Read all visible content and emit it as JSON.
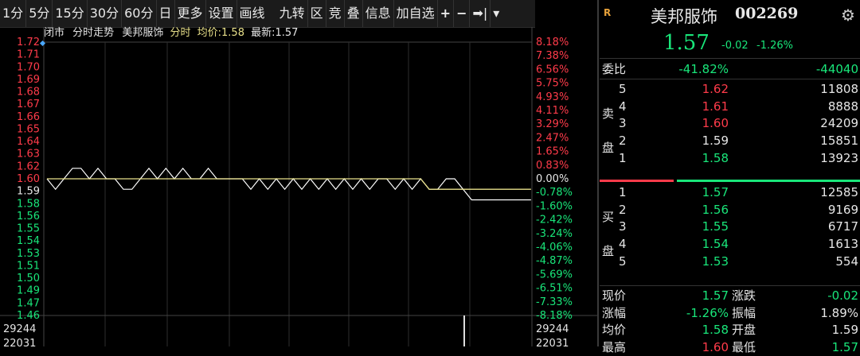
{
  "toolbar": {
    "items": [
      "1分",
      "5分",
      "15分",
      "30分",
      "60分",
      "日",
      "更多",
      "设置",
      "画线",
      "九转",
      "区",
      "竞",
      "叠",
      "信息",
      "加自选",
      "+",
      "−",
      "➡|",
      "▾"
    ]
  },
  "chart_caption": {
    "mode1": "闭市",
    "mode2": "分时走势",
    "name": "美邦服饰",
    "sub": "分时",
    "avg_label": "均价:",
    "avg": "1.58",
    "latest_label": "最新:",
    "latest": "1.57"
  },
  "chart_data": {
    "type": "line",
    "title": "",
    "xlabel": "",
    "ylabel": "",
    "ylim": [
      1.46,
      1.72
    ],
    "prev_close": 1.59,
    "y_ticks_left": [
      "1.72",
      "1.71",
      "1.70",
      "1.69",
      "1.68",
      "1.67",
      "1.66",
      "1.65",
      "1.64",
      "1.63",
      "1.62",
      "1.60",
      "1.59",
      "1.58",
      "1.56",
      "1.55",
      "1.54",
      "1.53",
      "1.51",
      "1.50",
      "1.49",
      "1.47",
      "1.46"
    ],
    "y_ticks_right": [
      "8.18%",
      "7.38%",
      "6.56%",
      "5.75%",
      "4.93%",
      "4.11%",
      "3.29%",
      "2.47%",
      "1.65%",
      "0.83%",
      "0.00%",
      "-0.78%",
      "-1.60%",
      "-2.42%",
      "-3.24%",
      "-4.06%",
      "-4.87%",
      "-5.69%",
      "-6.51%",
      "-7.33%",
      "-8.18%"
    ],
    "series": [
      {
        "values": [
          1.59,
          1.58,
          1.59,
          1.6,
          1.6,
          1.59,
          1.6,
          1.59,
          1.59,
          1.58,
          1.58,
          1.59,
          1.6,
          1.59,
          1.6,
          1.59,
          1.6,
          1.59,
          1.59,
          1.6,
          1.59,
          1.59,
          1.59,
          1.59,
          1.58,
          1.59,
          1.58,
          1.59,
          1.58,
          1.59,
          1.58,
          1.59,
          1.58,
          1.59,
          1.58,
          1.59,
          1.58,
          1.59,
          1.58,
          1.59,
          1.59,
          1.58,
          1.59,
          1.58,
          1.59,
          1.58,
          1.58,
          1.59,
          1.59,
          1.58,
          1.57,
          1.57,
          1.57,
          1.57,
          1.57,
          1.57,
          1.57,
          1.57
        ]
      },
      {
        "values": [
          1.59,
          1.59,
          1.59,
          1.59,
          1.59,
          1.59,
          1.59,
          1.59,
          1.59,
          1.59,
          1.59,
          1.59,
          1.59,
          1.59,
          1.59,
          1.59,
          1.59,
          1.59,
          1.59,
          1.59,
          1.59,
          1.59,
          1.59,
          1.59,
          1.59,
          1.59,
          1.59,
          1.59,
          1.59,
          1.59,
          1.59,
          1.59,
          1.59,
          1.59,
          1.59,
          1.59,
          1.59,
          1.59,
          1.59,
          1.59,
          1.59,
          1.59,
          1.59,
          1.59,
          1.59,
          1.58,
          1.58,
          1.58,
          1.58,
          1.58,
          1.58,
          1.58,
          1.58,
          1.58,
          1.58,
          1.58,
          1.58,
          1.58
        ]
      }
    ],
    "volume_labels": [
      "29244",
      "22031"
    ],
    "colors": {
      "price": "#ffffff",
      "avg": "#e8e08a",
      "up": "#ff3b4a",
      "down": "#19e67a"
    }
  },
  "quote": {
    "badge": "R",
    "name": "美邦服饰",
    "code": "002269",
    "price": "1.57",
    "change": "-0.02",
    "change_pct": "-1.26%",
    "weibi_label": "委比",
    "weibi_pct": "-41.82%",
    "weibi_val": "-44040",
    "sell_label": [
      "卖",
      "盘"
    ],
    "buy_label": [
      "买",
      "盘"
    ],
    "asks": [
      {
        "lvl": "5",
        "price": "1.62",
        "vol": "11808"
      },
      {
        "lvl": "4",
        "price": "1.61",
        "vol": "8888"
      },
      {
        "lvl": "3",
        "price": "1.60",
        "vol": "24209"
      },
      {
        "lvl": "2",
        "price": "1.59",
        "vol": "15851"
      },
      {
        "lvl": "1",
        "price": "1.58",
        "vol": "13923"
      }
    ],
    "bids": [
      {
        "lvl": "1",
        "price": "1.57",
        "vol": "12585"
      },
      {
        "lvl": "2",
        "price": "1.56",
        "vol": "9169"
      },
      {
        "lvl": "3",
        "price": "1.55",
        "vol": "6717"
      },
      {
        "lvl": "4",
        "price": "1.54",
        "vol": "1613"
      },
      {
        "lvl": "5",
        "price": "1.53",
        "vol": "554"
      }
    ],
    "stats": [
      {
        "l1": "现价",
        "v1": "1.57",
        "l2": "涨跌",
        "v2": "-0.02"
      },
      {
        "l1": "涨幅",
        "v1": "-1.26%",
        "l2": "振幅",
        "v2": "1.89%"
      },
      {
        "l1": "均价",
        "v1": "1.58",
        "l2": "开盘",
        "v2": "1.59"
      },
      {
        "l1": "最高",
        "v1": "1.60",
        "l2": "最低",
        "v2": "1.57"
      }
    ]
  }
}
